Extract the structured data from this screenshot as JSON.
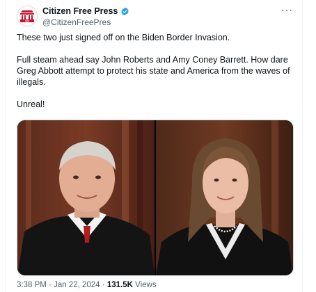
{
  "author": {
    "display_name": "Citizen Free Press",
    "handle": "@CitizenFreePres",
    "logo_text": "US",
    "verified_color": "#1d9bf0"
  },
  "more_label": "···",
  "tweet": {
    "paragraphs": [
      "These two just signed off on the Biden Border Invasion.",
      "Full steam ahead say John Roberts and Amy Coney Barrett. How dare Greg Abbott attempt to protect his state and America from the waves of illegals.",
      "Unreal!"
    ]
  },
  "meta": {
    "time": "3:38 PM",
    "separator": "·",
    "date": "Jan 22, 2024",
    "views_count": "131.5K",
    "views_label": "Views"
  },
  "colors": {
    "text": "#0f1419",
    "secondary": "#536471",
    "border": "#eff3f4"
  }
}
